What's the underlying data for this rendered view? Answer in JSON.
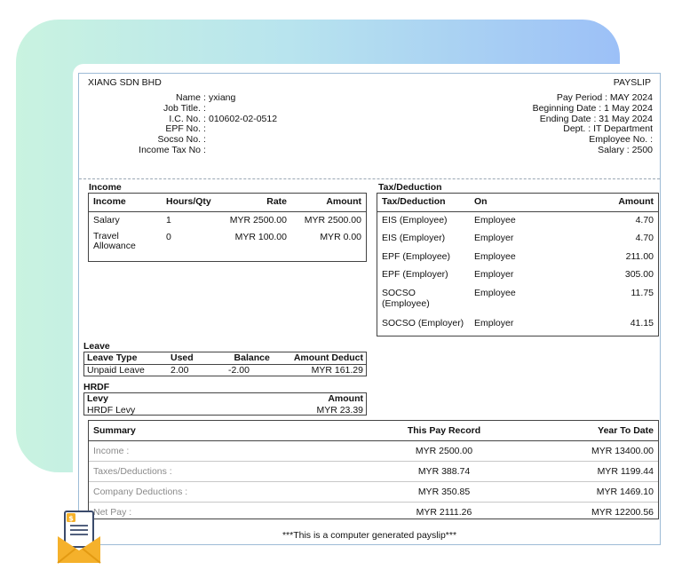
{
  "header": {
    "company": "XIANG SDN BHD",
    "title": "PAYSLIP"
  },
  "employee": [
    {
      "label": "Name",
      "value": "yxiang"
    },
    {
      "label": "Job Title.",
      "value": ""
    },
    {
      "label": "I.C. No.",
      "value": "010602-02-0512"
    },
    {
      "label": "EPF No.",
      "value": ""
    },
    {
      "label": "Socso No.",
      "value": ""
    },
    {
      "label": "Income Tax No",
      "value": ""
    }
  ],
  "period": [
    "Pay Period : MAY 2024",
    "Beginning Date : 1 May 2024",
    "Ending Date : 31 May 2024",
    "Dept. : IT Department",
    "Employee No. :",
    "Salary : 2500"
  ],
  "income": {
    "section_title": "Income",
    "headers": [
      "Income",
      "Hours/Qty",
      "Rate",
      "Amount"
    ],
    "rows": [
      [
        "Salary",
        "1",
        "MYR 2500.00",
        "MYR 2500.00"
      ],
      [
        "Travel Allowance",
        "0",
        "MYR 100.00",
        "MYR 0.00"
      ]
    ]
  },
  "tax": {
    "section_title": "Tax/Deduction",
    "headers": [
      "Tax/Deduction",
      "On",
      "Amount"
    ],
    "rows": [
      [
        "EIS (Employee)",
        "Employee",
        "4.70"
      ],
      [
        "EIS (Employer)",
        "Employer",
        "4.70"
      ],
      [
        "EPF (Employee)",
        "Employee",
        "211.00"
      ],
      [
        "EPF (Employer)",
        "Employer",
        "305.00"
      ],
      [
        "SOCSO (Employee)",
        "Employee",
        "11.75"
      ],
      [
        "SOCSO (Employer)",
        "Employer",
        "41.15"
      ]
    ]
  },
  "leave": {
    "section_title": "Leave",
    "headers": [
      "Leave Type",
      "Used",
      "Balance",
      "Amount Deduct"
    ],
    "rows": [
      [
        "Unpaid Leave",
        "2.00",
        "-2.00",
        "MYR 161.29"
      ]
    ]
  },
  "hrdf": {
    "section_title": "HRDF",
    "headers": [
      "Levy",
      "Amount"
    ],
    "rows": [
      [
        "HRDF Levy",
        "MYR 23.39"
      ]
    ]
  },
  "summary": {
    "headers": [
      "Summary",
      "This Pay Record",
      "Year To Date"
    ],
    "rows": [
      [
        "Income :",
        "MYR 2500.00",
        "MYR 13400.00"
      ],
      [
        "Taxes/Deductions :",
        "MYR 388.74",
        "MYR 1199.44"
      ],
      [
        "Company Deductions :",
        "MYR 350.85",
        "MYR 1469.10"
      ],
      [
        "Net Pay :",
        "MYR 2111.26",
        "MYR 12200.56"
      ]
    ]
  },
  "footer": "***This is a computer generated payslip***",
  "icon": {
    "name": "payslip-envelope-icon",
    "badge": "$",
    "accent": "#f5b12b"
  },
  "colors": {
    "gradient_start": "#c9f3e0",
    "gradient_end": "#9cc0f7",
    "border": "#9dbbd6"
  }
}
